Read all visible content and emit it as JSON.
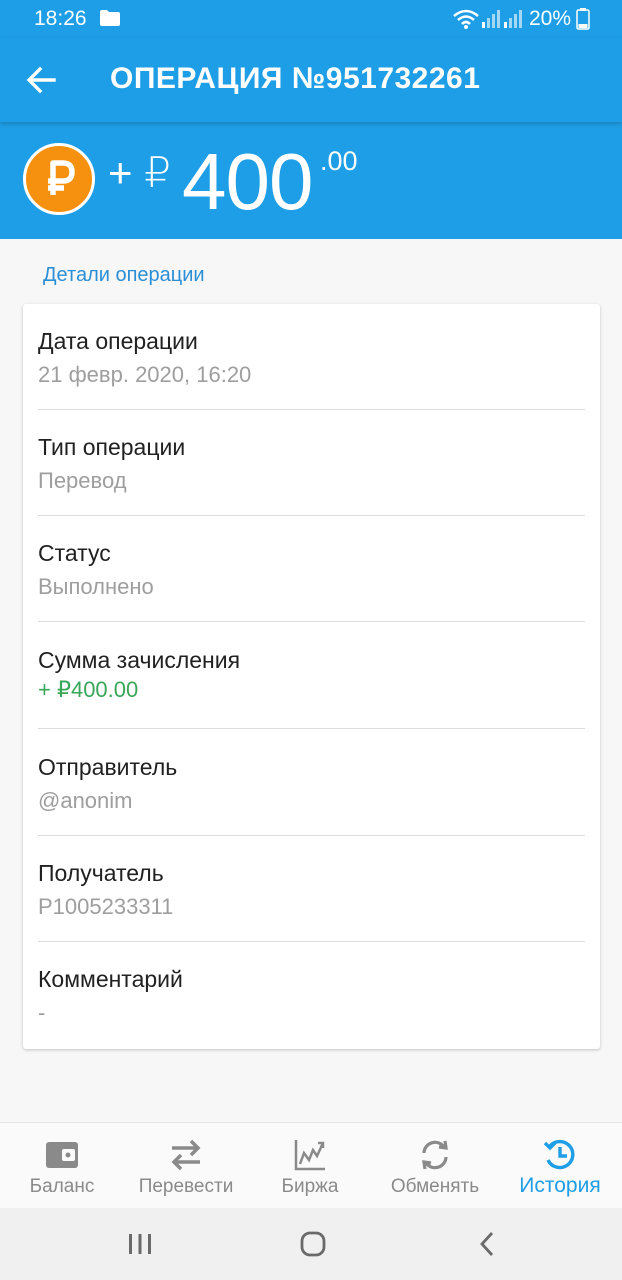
{
  "status_bar": {
    "time": "18:26",
    "battery": "20%"
  },
  "header": {
    "title": "ОПЕРАЦИЯ №951732261"
  },
  "amount": {
    "sign": "+ ₽",
    "whole": "400",
    "cents": ".00",
    "coin_color": "#f5910f"
  },
  "section": {
    "title": "Детали операции"
  },
  "details": [
    {
      "label": "Дата операции",
      "value": "21 февр. 2020, 16:20"
    },
    {
      "label": "Тип операции",
      "value": "Перевод"
    },
    {
      "label": "Статус",
      "value": "Выполнено"
    },
    {
      "label": "Сумма зачисления",
      "value": "+ ₽400.00"
    },
    {
      "label": "Отправитель",
      "value": "@anonim"
    },
    {
      "label": "Получатель",
      "value": "P1005233311"
    },
    {
      "label": "Комментарий",
      "value": "-"
    }
  ],
  "bottom_nav": [
    {
      "label": "Баланс",
      "icon": "wallet-icon"
    },
    {
      "label": "Перевести",
      "icon": "transfer-icon"
    },
    {
      "label": "Биржа",
      "icon": "chart-icon"
    },
    {
      "label": "Обменять",
      "icon": "exchange-icon"
    },
    {
      "label": "История",
      "icon": "history-icon",
      "active": true
    }
  ],
  "colors": {
    "primary": "#1e9ee6",
    "accent_text": "#2b8fd6",
    "positive": "#3aa65a"
  }
}
